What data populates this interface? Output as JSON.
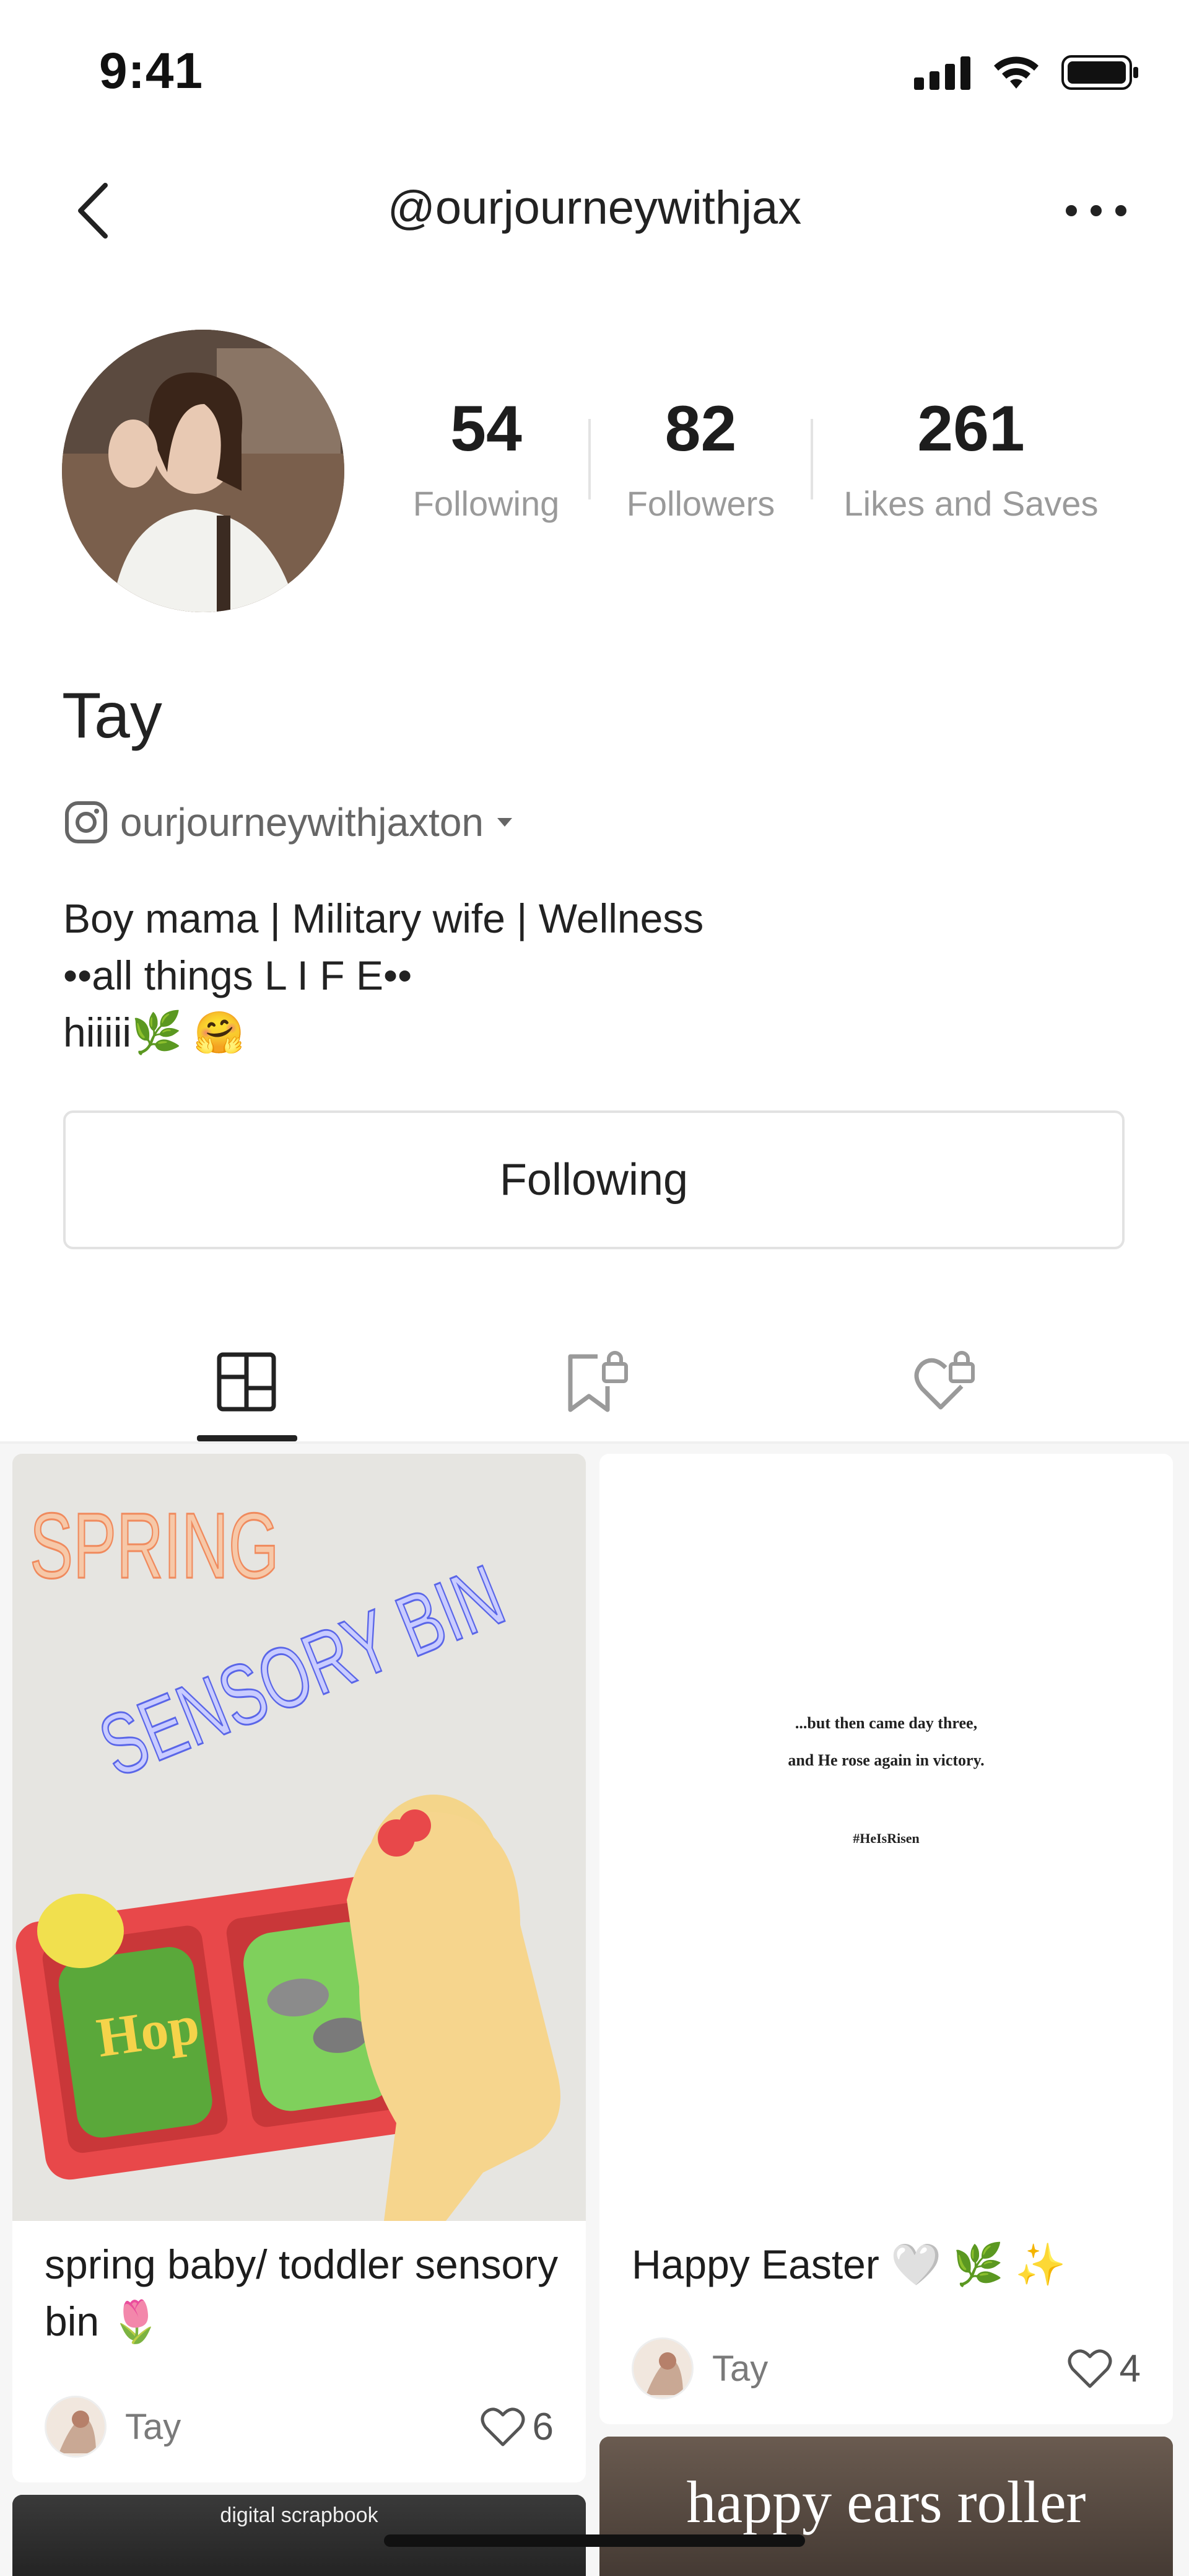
{
  "status_bar": {
    "time": "9:41"
  },
  "header": {
    "title": "@ourjourneywithjax"
  },
  "profile": {
    "name": "Tay",
    "instagram_handle": "ourjourneywithjaxton",
    "bio_lines": [
      "Boy mama | Military wife | Wellness",
      "••all things L I F E••",
      "hiiiii🌿 🤗"
    ],
    "stats": [
      {
        "value": "54",
        "label": "Following"
      },
      {
        "value": "82",
        "label": "Followers"
      },
      {
        "value": "261",
        "label": "Likes and Saves"
      }
    ],
    "follow_button": "Following"
  },
  "tabs": [
    {
      "icon": "grid-icon",
      "active": true
    },
    {
      "icon": "bookmark-lock-icon",
      "active": false
    },
    {
      "icon": "heart-lock-icon",
      "active": false
    }
  ],
  "posts": [
    {
      "title": "spring baby/ toddler sensory bin 🌷",
      "author": "Tay",
      "likes": "6",
      "image_text": {
        "line1": "SPRING",
        "line2": "SENSORY BIN",
        "tray_letters": "Hop"
      }
    },
    {
      "title": "Happy Easter 🤍 🌿 ✨",
      "author": "Tay",
      "likes": "4",
      "image_text": {
        "line1": "...but then came day three,",
        "line2": "and He rose again in victory.",
        "line3": "#HeIsRisen"
      }
    },
    {
      "image_text": "digital scrapbook"
    },
    {
      "image_text": "happy ears roller"
    }
  ],
  "colors": {
    "accent": "#222222",
    "muted": "#9a9a9a",
    "divider": "#e3e3e3"
  }
}
